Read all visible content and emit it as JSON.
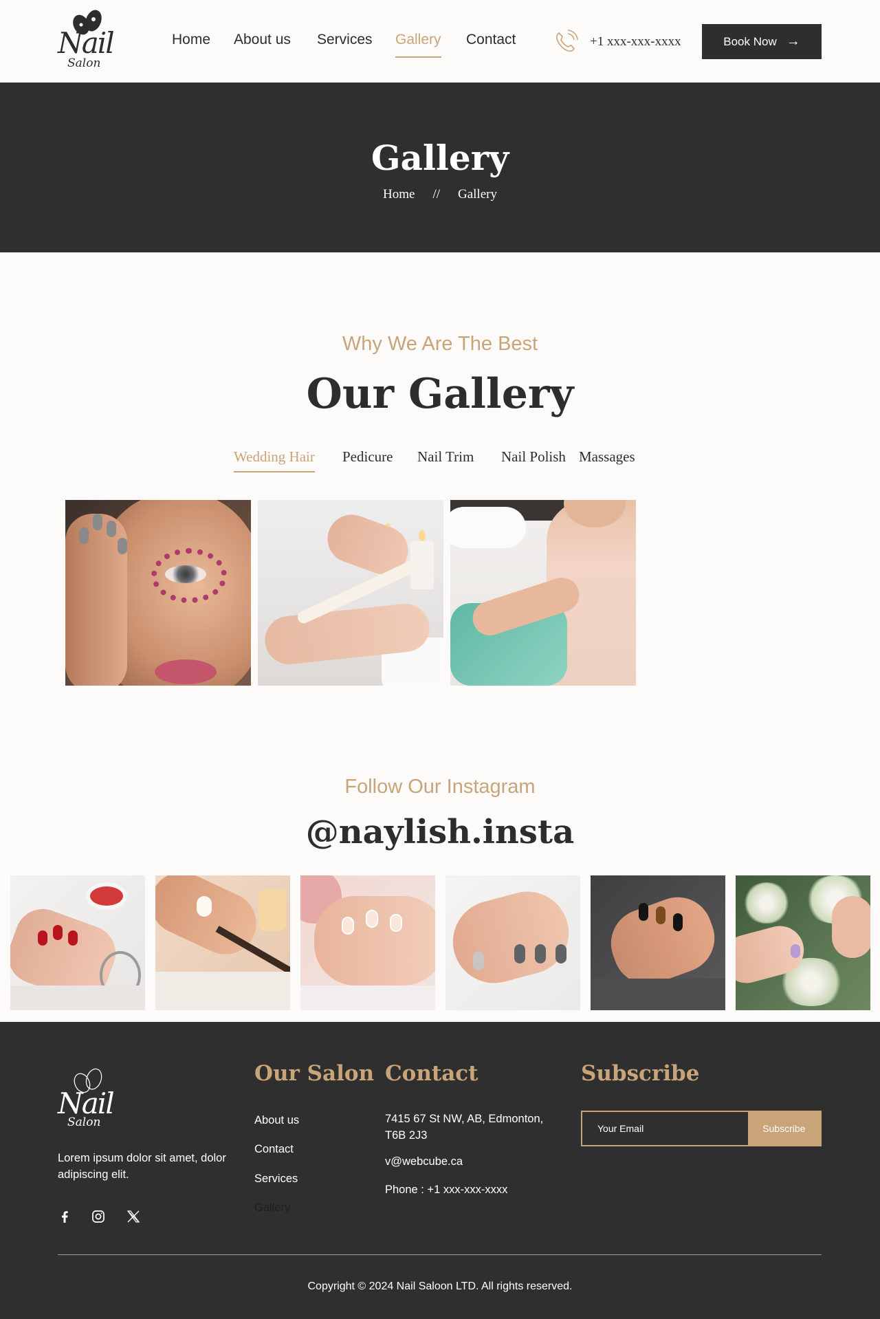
{
  "brand": {
    "logo_word": "Nail",
    "logo_sub": "Salon"
  },
  "nav": {
    "items": [
      {
        "label": "Home"
      },
      {
        "label": "About us"
      },
      {
        "label": "Services"
      },
      {
        "label": "Gallery"
      },
      {
        "label": "Contact"
      }
    ],
    "active": "Gallery"
  },
  "contact_bar": {
    "phone": "+1 xxx-xxx-xxxx",
    "phone_icon": "phone-icon"
  },
  "book_button": {
    "label": "Book Now",
    "arrow": "→"
  },
  "banner": {
    "title": "Gallery",
    "breadcrumb": {
      "home": "Home",
      "separator": "//",
      "current": "Gallery"
    }
  },
  "gallery": {
    "eyebrow": "Why We Are The Best",
    "title": "Our Gallery",
    "tabs": [
      {
        "label": "Wedding Hair"
      },
      {
        "label": "Pedicure"
      },
      {
        "label": "Nail Trim"
      },
      {
        "label": "Nail Polish"
      },
      {
        "label": "Massages"
      }
    ],
    "active_tab": "Wedding Hair"
  },
  "instagram": {
    "eyebrow": "Follow Our Instagram",
    "handle": "@naylish.insta"
  },
  "footer": {
    "description": "Lorem ipsum dolor sit amet, dolor adipiscing elit.",
    "social_icons": [
      "facebook-icon",
      "instagram-icon",
      "x-twitter-icon"
    ],
    "our_salon": {
      "heading": "Our Salon",
      "links": [
        "About us",
        "Contact",
        "Services",
        "Gallery"
      ]
    },
    "contact": {
      "heading": "Contact",
      "address": "7415 67 St NW, AB, Edmonton, T6B 2J3",
      "email": "v@webcube.ca",
      "phone": "Phone : +1 xxx-xxx-xxxx"
    },
    "subscribe": {
      "heading": "Subscribe",
      "placeholder": "Your Email",
      "button": "Subscribe"
    },
    "copyright": "Copyright © 2024 Nail Saloon LTD. All rights reserved."
  },
  "colors": {
    "accent": "#c9a479",
    "dark": "#2f2f2f",
    "background": "#fdfbfa"
  }
}
